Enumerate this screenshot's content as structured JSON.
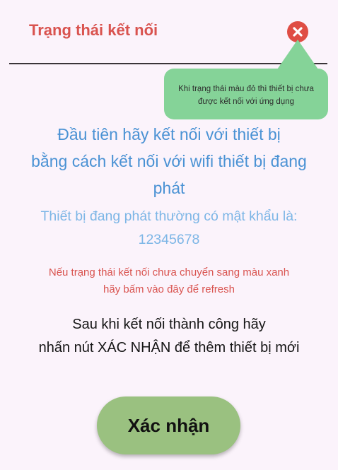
{
  "header": {
    "title": "Trạng thái kết nối",
    "status_icon": "close-circle-icon",
    "status_color": "#df4d44"
  },
  "tooltip": {
    "lines": [
      "Khi trạng thái màu đỏ thì thiết bị chưa",
      "được kết nối với ứng dụng"
    ],
    "color": "#85d398"
  },
  "instructions": {
    "primary_lines": [
      "Đầu tiên hãy kết nối với thiết bị",
      "bằng cách kết nối với wifi thiết bị đang",
      "phát"
    ],
    "password_lines": [
      "Thiết bị đang phát thường có mật khẩu là:",
      "12345678"
    ],
    "refresh_lines": [
      "Nếu trạng thái kết nối chưa chuyển sang màu xanh",
      "hãy bấm vào đây để refresh"
    ],
    "final_lines": [
      "Sau khi kết nối thành công hãy",
      "nhấn nút XÁC NHẬN để thêm thiết bị mới"
    ]
  },
  "confirm_button": {
    "label": "Xác nhận",
    "color": "#9ac180"
  },
  "colors": {
    "background": "#fbf3fb",
    "title_red": "#d9534f",
    "primary_blue": "#4a92d4",
    "light_blue": "#7db6e6"
  }
}
